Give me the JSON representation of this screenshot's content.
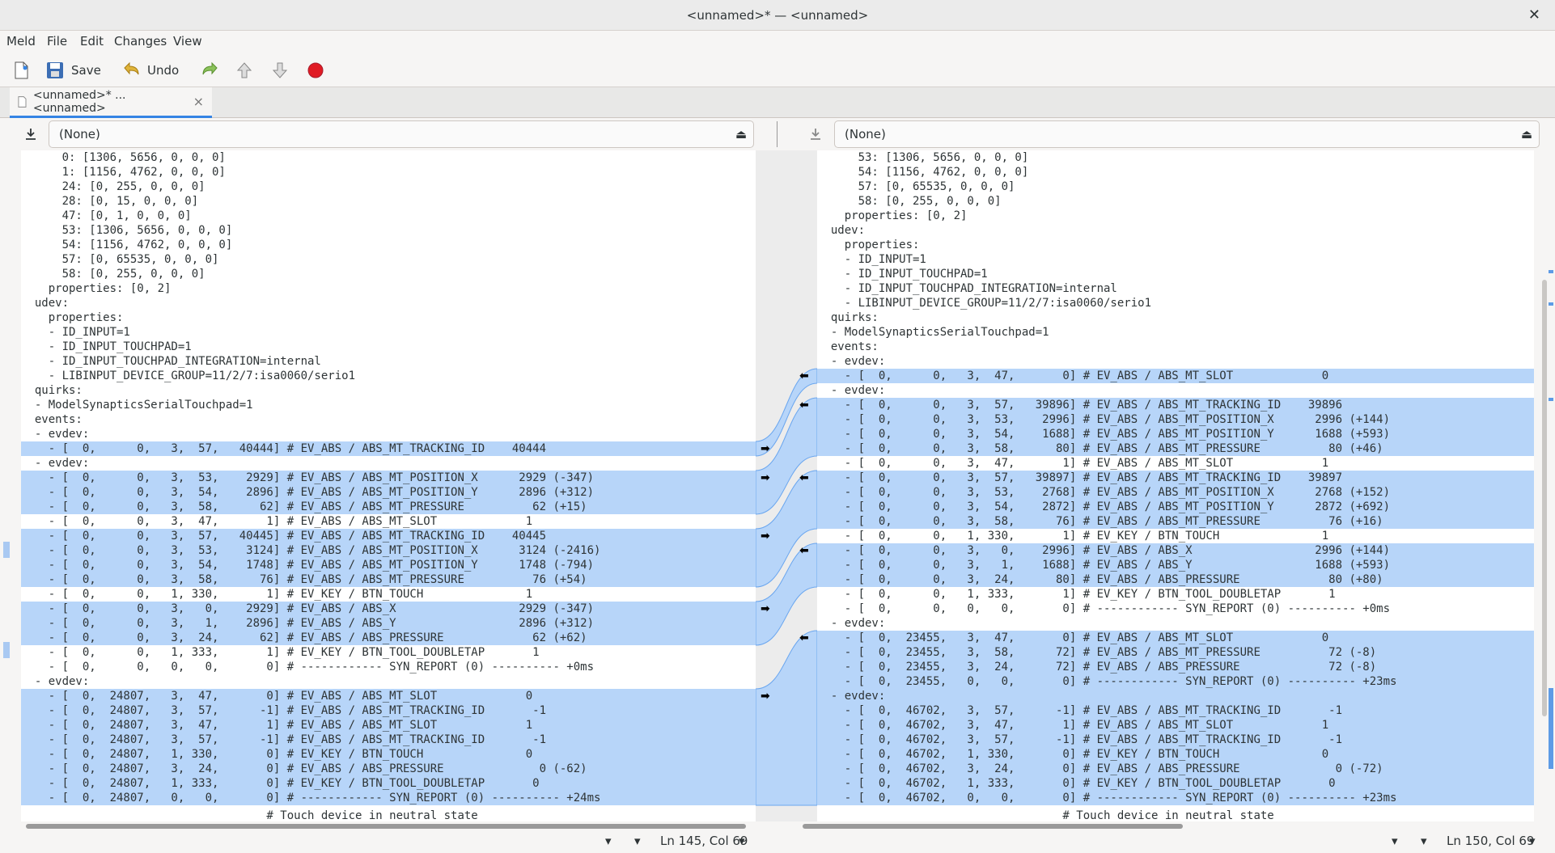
{
  "window": {
    "title": "<unnamed>* — <unnamed>",
    "close_glyph": "✕"
  },
  "menu": {
    "meld": "Meld",
    "file": "File",
    "edit": "Edit",
    "changes": "Changes",
    "view": "View"
  },
  "toolbar": {
    "save": "Save",
    "undo": "Undo"
  },
  "tab": {
    "label": "<unnamed>* ... <unnamed>",
    "close": "×"
  },
  "left": {
    "file_combo": "(None)",
    "status": "Ln 145, Col 69",
    "last": "                                    # Touch device in neutral state"
  },
  "right": {
    "file_combo": "(None)",
    "status": "Ln 150, Col 69",
    "last": "                                    # Touch device in neutral state"
  },
  "colors": {
    "change": "#b7d5f9",
    "highlight": "#7fb3f2"
  },
  "left_lines": [
    {
      "t": "      0: [1306, 5656, 0, 0, 0]",
      "c": 0
    },
    {
      "t": "      1: [1156, 4762, 0, 0, 0]",
      "c": 0
    },
    {
      "t": "      24: [0, 255, 0, 0, 0]",
      "c": 0
    },
    {
      "t": "      28: [0, 15, 0, 0, 0]",
      "c": 0
    },
    {
      "t": "      47: [0, 1, 0, 0, 0]",
      "c": 0
    },
    {
      "t": "      53: [1306, 5656, 0, 0, 0]",
      "c": 0
    },
    {
      "t": "      54: [1156, 4762, 0, 0, 0]",
      "c": 0
    },
    {
      "t": "      57: [0, 65535, 0, 0, 0]",
      "c": 0
    },
    {
      "t": "      58: [0, 255, 0, 0, 0]",
      "c": 0
    },
    {
      "t": "    properties: [0, 2]",
      "c": 0
    },
    {
      "t": "  udev:",
      "c": 0
    },
    {
      "t": "    properties:",
      "c": 0
    },
    {
      "t": "    - ID_INPUT=1",
      "c": 0
    },
    {
      "t": "    - ID_INPUT_TOUCHPAD=1",
      "c": 0
    },
    {
      "t": "    - ID_INPUT_TOUCHPAD_INTEGRATION=internal",
      "c": 0
    },
    {
      "t": "    - LIBINPUT_DEVICE_GROUP=11/2/7:isa0060/serio1",
      "c": 0
    },
    {
      "t": "  quirks:",
      "c": 0
    },
    {
      "t": "  - ModelSynapticsSerialTouchpad=1",
      "c": 0
    },
    {
      "t": "  events:",
      "c": 0
    },
    {
      "t": "  - evdev:",
      "c": 0
    },
    {
      "t": "    - [  0,      0,   3,  57,   40444] # EV_ABS / ABS_MT_TRACKING_ID    40444",
      "c": 1
    },
    {
      "t": "  - evdev:",
      "c": 0
    },
    {
      "t": "    - [  0,      0,   3,  53,    2929] # EV_ABS / ABS_MT_POSITION_X      2929 (-347)",
      "c": 1
    },
    {
      "t": "    - [  0,      0,   3,  54,    2896] # EV_ABS / ABS_MT_POSITION_Y      2896 (+312)",
      "c": 1
    },
    {
      "t": "    - [  0,      0,   3,  58,      62] # EV_ABS / ABS_MT_PRESSURE          62 (+15)",
      "c": 1
    },
    {
      "t": "    - [  0,      0,   3,  47,       1] # EV_ABS / ABS_MT_SLOT             1",
      "c": 0
    },
    {
      "t": "    - [  0,      0,   3,  57,   40445] # EV_ABS / ABS_MT_TRACKING_ID    40445",
      "c": 1
    },
    {
      "t": "    - [  0,      0,   3,  53,    3124] # EV_ABS / ABS_MT_POSITION_X      3124 (-2416)",
      "c": 1
    },
    {
      "t": "    - [  0,      0,   3,  54,    1748] # EV_ABS / ABS_MT_POSITION_Y      1748 (-794)",
      "c": 1
    },
    {
      "t": "    - [  0,      0,   3,  58,      76] # EV_ABS / ABS_MT_PRESSURE          76 (+54)",
      "c": 1
    },
    {
      "t": "    - [  0,      0,   1, 330,       1] # EV_KEY / BTN_TOUCH               1",
      "c": 0
    },
    {
      "t": "    - [  0,      0,   3,   0,    2929] # EV_ABS / ABS_X                  2929 (-347)",
      "c": 1
    },
    {
      "t": "    - [  0,      0,   3,   1,    2896] # EV_ABS / ABS_Y                  2896 (+312)",
      "c": 1
    },
    {
      "t": "    - [  0,      0,   3,  24,      62] # EV_ABS / ABS_PRESSURE             62 (+62)",
      "c": 1
    },
    {
      "t": "    - [  0,      0,   1, 333,       1] # EV_KEY / BTN_TOOL_DOUBLETAP       1",
      "c": 0
    },
    {
      "t": "    - [  0,      0,   0,   0,       0] # ------------ SYN_REPORT (0) ---------- +0ms",
      "c": 0
    },
    {
      "t": "  - evdev:",
      "c": 0
    },
    {
      "t": "    - [  0,  24807,   3,  47,       0] # EV_ABS / ABS_MT_SLOT             0",
      "c": 1
    },
    {
      "t": "    - [  0,  24807,   3,  57,      -1] # EV_ABS / ABS_MT_TRACKING_ID       -1",
      "c": 1
    },
    {
      "t": "    - [  0,  24807,   3,  47,       1] # EV_ABS / ABS_MT_SLOT             1",
      "c": 1
    },
    {
      "t": "    - [  0,  24807,   3,  57,      -1] # EV_ABS / ABS_MT_TRACKING_ID       -1",
      "c": 1
    },
    {
      "t": "    - [  0,  24807,   1, 330,       0] # EV_KEY / BTN_TOUCH               0",
      "c": 1
    },
    {
      "t": "    - [  0,  24807,   3,  24,       0] # EV_ABS / ABS_PRESSURE              0 (-62)",
      "c": 1
    },
    {
      "t": "    - [  0,  24807,   1, 333,       0] # EV_KEY / BTN_TOOL_DOUBLETAP       0",
      "c": 1
    },
    {
      "t": "    - [  0,  24807,   0,   0,       0] # ------------ SYN_REPORT (0) ---------- +24ms",
      "c": 1
    }
  ],
  "right_lines": [
    {
      "t": "      53: [1306, 5656, 0, 0, 0]",
      "c": 0
    },
    {
      "t": "      54: [1156, 4762, 0, 0, 0]",
      "c": 0
    },
    {
      "t": "      57: [0, 65535, 0, 0, 0]",
      "c": 0
    },
    {
      "t": "      58: [0, 255, 0, 0, 0]",
      "c": 0
    },
    {
      "t": "    properties: [0, 2]",
      "c": 0
    },
    {
      "t": "  udev:",
      "c": 0
    },
    {
      "t": "    properties:",
      "c": 0
    },
    {
      "t": "    - ID_INPUT=1",
      "c": 0
    },
    {
      "t": "    - ID_INPUT_TOUCHPAD=1",
      "c": 0
    },
    {
      "t": "    - ID_INPUT_TOUCHPAD_INTEGRATION=internal",
      "c": 0
    },
    {
      "t": "    - LIBINPUT_DEVICE_GROUP=11/2/7:isa0060/serio1",
      "c": 0
    },
    {
      "t": "  quirks:",
      "c": 0
    },
    {
      "t": "  - ModelSynapticsSerialTouchpad=1",
      "c": 0
    },
    {
      "t": "  events:",
      "c": 0
    },
    {
      "t": "  - evdev:",
      "c": 0
    },
    {
      "t": "    - [  0,      0,   3,  47,       0] # EV_ABS / ABS_MT_SLOT             0",
      "c": 1
    },
    {
      "t": "  - evdev:",
      "c": 0
    },
    {
      "t": "    - [  0,      0,   3,  57,   39896] # EV_ABS / ABS_MT_TRACKING_ID    39896",
      "c": 1
    },
    {
      "t": "    - [  0,      0,   3,  53,    2996] # EV_ABS / ABS_MT_POSITION_X      2996 (+144)",
      "c": 1
    },
    {
      "t": "    - [  0,      0,   3,  54,    1688] # EV_ABS / ABS_MT_POSITION_Y      1688 (+593)",
      "c": 1
    },
    {
      "t": "    - [  0,      0,   3,  58,      80] # EV_ABS / ABS_MT_PRESSURE          80 (+46)",
      "c": 1
    },
    {
      "t": "    - [  0,      0,   3,  47,       1] # EV_ABS / ABS_MT_SLOT             1",
      "c": 0
    },
    {
      "t": "    - [  0,      0,   3,  57,   39897] # EV_ABS / ABS_MT_TRACKING_ID    39897",
      "c": 1
    },
    {
      "t": "    - [  0,      0,   3,  53,    2768] # EV_ABS / ABS_MT_POSITION_X      2768 (+152)",
      "c": 1
    },
    {
      "t": "    - [  0,      0,   3,  54,    2872] # EV_ABS / ABS_MT_POSITION_Y      2872 (+692)",
      "c": 1
    },
    {
      "t": "    - [  0,      0,   3,  58,      76] # EV_ABS / ABS_MT_PRESSURE          76 (+16)",
      "c": 1
    },
    {
      "t": "    - [  0,      0,   1, 330,       1] # EV_KEY / BTN_TOUCH               1",
      "c": 0
    },
    {
      "t": "    - [  0,      0,   3,   0,    2996] # EV_ABS / ABS_X                  2996 (+144)",
      "c": 1
    },
    {
      "t": "    - [  0,      0,   3,   1,    1688] # EV_ABS / ABS_Y                  1688 (+593)",
      "c": 1
    },
    {
      "t": "    - [  0,      0,   3,  24,      80] # EV_ABS / ABS_PRESSURE             80 (+80)",
      "c": 1
    },
    {
      "t": "    - [  0,      0,   1, 333,       1] # EV_KEY / BTN_TOOL_DOUBLETAP       1",
      "c": 0
    },
    {
      "t": "    - [  0,      0,   0,   0,       0] # ------------ SYN_REPORT (0) ---------- +0ms",
      "c": 0
    },
    {
      "t": "  - evdev:",
      "c": 0
    },
    {
      "t": "    - [  0,  23455,   3,  47,       0] # EV_ABS / ABS_MT_SLOT             0",
      "c": 1
    },
    {
      "t": "    - [  0,  23455,   3,  58,      72] # EV_ABS / ABS_MT_PRESSURE          72 (-8)",
      "c": 1
    },
    {
      "t": "    - [  0,  23455,   3,  24,      72] # EV_ABS / ABS_PRESSURE             72 (-8)",
      "c": 1
    },
    {
      "t": "    - [  0,  23455,   0,   0,       0] # ------------ SYN_REPORT (0) ---------- +23ms",
      "c": 1
    },
    {
      "t": "  - evdev:",
      "c": 1
    },
    {
      "t": "    - [  0,  46702,   3,  57,      -1] # EV_ABS / ABS_MT_TRACKING_ID       -1",
      "c": 1
    },
    {
      "t": "    - [  0,  46702,   3,  47,       1] # EV_ABS / ABS_MT_SLOT             1",
      "c": 1
    },
    {
      "t": "    - [  0,  46702,   3,  57,      -1] # EV_ABS / ABS_MT_TRACKING_ID       -1",
      "c": 1
    },
    {
      "t": "    - [  0,  46702,   1, 330,       0] # EV_KEY / BTN_TOUCH               0",
      "c": 1
    },
    {
      "t": "    - [  0,  46702,   3,  24,       0] # EV_ABS / ABS_PRESSURE              0 (-72)",
      "c": 1
    },
    {
      "t": "    - [  0,  46702,   1, 333,       0] # EV_KEY / BTN_TOOL_DOUBLETAP       0",
      "c": 1
    },
    {
      "t": "    - [  0,  46702,   0,   0,       0] # ------------ SYN_REPORT (0) ---------- +23ms",
      "c": 1
    }
  ]
}
